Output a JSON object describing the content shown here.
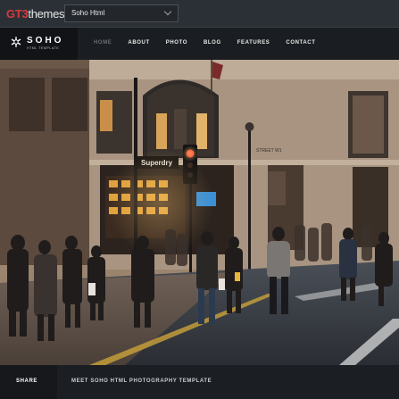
{
  "topbar": {
    "logo_brand": "GT3",
    "logo_suffix": "themes",
    "theme_select": {
      "value": "Soho Html"
    }
  },
  "header": {
    "brand": {
      "name": "SOHO",
      "tagline": "HTML TEMPLATE"
    },
    "nav": [
      {
        "label": "HOME",
        "active": true
      },
      {
        "label": "ABOUT",
        "active": false
      },
      {
        "label": "PHOTO",
        "active": false
      },
      {
        "label": "BLOG",
        "active": false
      },
      {
        "label": "FEATURES",
        "active": false
      },
      {
        "label": "CONTACT",
        "active": false
      }
    ]
  },
  "hero": {
    "sign_text": "Superdry",
    "street_text": "STREET W1"
  },
  "footer": {
    "share_label": "SHARE",
    "caption": "MEET SOHO HTML PHOTOGRAPHY TEMPLATE"
  },
  "colors": {
    "accent": "#d63b3b",
    "nav_active": "#6a7078",
    "bar": "#2b3036"
  },
  "icons": {
    "brand": "snowflake-gear-icon",
    "select": "chevron-down-icon"
  }
}
